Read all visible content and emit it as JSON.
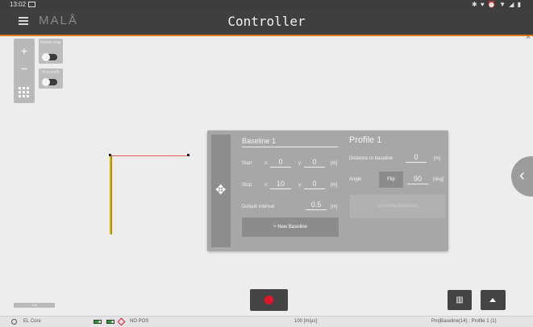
{
  "status_bar": {
    "time": "13:02",
    "system_icons": "✱ ♥ ⏰ ▼ ◢ ▮"
  },
  "app_bar": {
    "logo": "MALÅ",
    "title": "Controller"
  },
  "edge_mark": "A",
  "map_controls": {
    "zoom_in": "+",
    "zoom_out": "−",
    "rotate_map_label": "Rotate map",
    "n_is_north_label": "N is north",
    "scale_label": "1 m"
  },
  "dialog": {
    "baseline_name": "Baseline 1",
    "start_label": "Start",
    "start_x": "0",
    "start_y": "0",
    "stop_label": "Stop",
    "stop_x": "10",
    "stop_y": "0",
    "x_label": "x:",
    "y_label": "y:",
    "unit_m": "[m]",
    "default_interval_label": "Default interval",
    "default_interval": "0.5",
    "new_baseline_button": "+ New Baseline",
    "profile_title": "Profile 1",
    "distance_label": "Distance to baseline",
    "distance_value": "0",
    "angle_label": "Angle",
    "flip_button": "Flip",
    "angle_value": "90",
    "unit_deg": "[deg]",
    "crossing_button": "Crossing Baseline"
  },
  "bottom_bar": {
    "device": "EL Core",
    "pos_status": "NO POS",
    "speed": "100 [m/µs]",
    "project_info": "Pro|Baseline(14) : Profile 1 (1)"
  },
  "colors": {
    "accent": "#e07b1a",
    "record": "#e4142a",
    "baseline_x": "#ee5555",
    "baseline_y": "#d4b000"
  }
}
